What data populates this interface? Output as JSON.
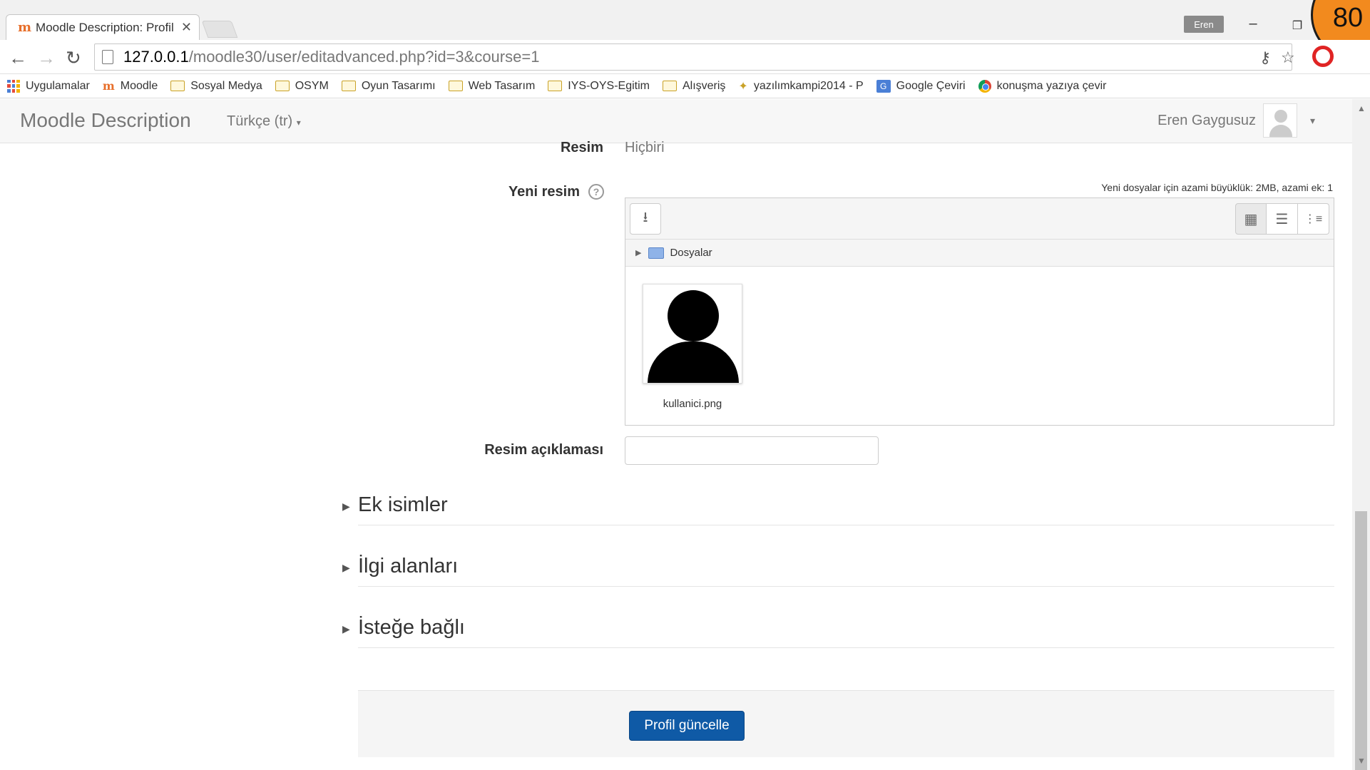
{
  "browser": {
    "tab_title": "Moodle Description: Profil",
    "profile_name": "Eren",
    "badge": "80",
    "url_host": "127.0.0.1",
    "url_path": "/moodle30/user/editadvanced.php?id=3&course=1"
  },
  "bookmarks": [
    {
      "label": "Uygulamalar",
      "icon": "apps-icon"
    },
    {
      "label": "Moodle",
      "icon": "moodle-icon"
    },
    {
      "label": "Sosyal Medya",
      "icon": "folder-icon"
    },
    {
      "label": "OSYM",
      "icon": "folder-icon"
    },
    {
      "label": "Oyun Tasarımı",
      "icon": "folder-icon"
    },
    {
      "label": "Web Tasarım",
      "icon": "folder-icon"
    },
    {
      "label": "IYS-OYS-Egitim",
      "icon": "folder-icon"
    },
    {
      "label": "Alışveriş",
      "icon": "folder-icon"
    },
    {
      "label": "yazılımkampi2014 - P",
      "icon": "site-icon"
    },
    {
      "label": "Google Çeviri",
      "icon": "translate-icon"
    },
    {
      "label": "konuşma yazıya çevir",
      "icon": "chrome-icon"
    }
  ],
  "navbar": {
    "brand": "Moodle Description",
    "language": "Türkçe (tr)",
    "user_name": "Eren Gaygusuz"
  },
  "form": {
    "current_picture_label": "Resim",
    "current_picture_value": "Hiçbiri",
    "new_picture_label": "Yeni resim",
    "max_info": "Yeni dosyalar için azami büyüklük: 2MB, azami ek: 1",
    "files_folder": "Dosyalar",
    "file_name": "kullanici.png",
    "picture_description_label": "Resim açıklaması",
    "picture_description_value": ""
  },
  "sections": [
    {
      "label": "Ek isimler"
    },
    {
      "label": "İlgi alanları"
    },
    {
      "label": "İsteğe bağlı"
    }
  ],
  "submit_label": "Profil güncelle",
  "colors": {
    "primary_button": "#0f5aa6",
    "badge": "#f28a1e"
  }
}
